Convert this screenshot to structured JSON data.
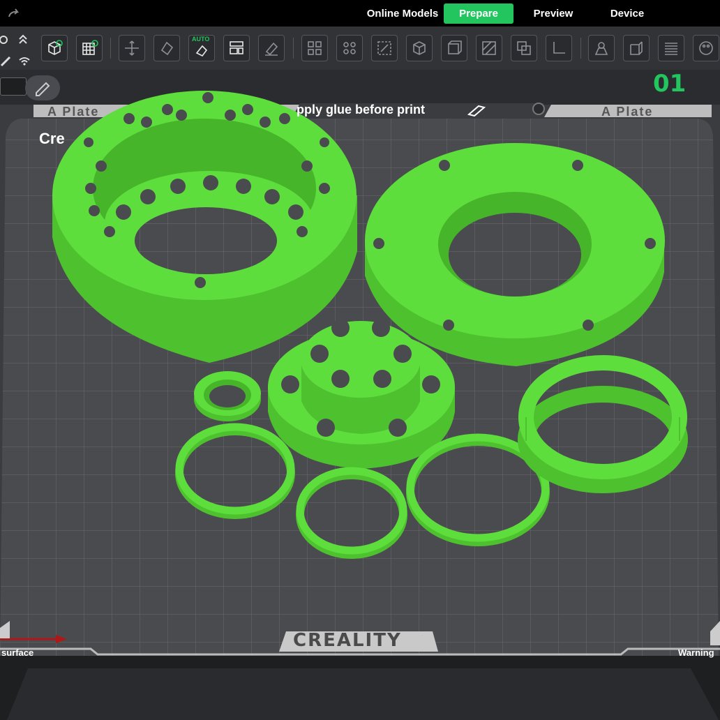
{
  "nav": {
    "tabs": [
      {
        "label": "Online Models",
        "active": false
      },
      {
        "label": "Prepare",
        "active": true
      },
      {
        "label": "Preview",
        "active": false
      },
      {
        "label": "Device",
        "active": false
      }
    ]
  },
  "toolbar": {
    "auto_label": "AUTO",
    "tools": [
      "add-object-icon",
      "add-plate-icon",
      "arrange-icon",
      "orient-icon",
      "auto-orient-icon",
      "layout-icon",
      "paint-icon",
      "split-objects-icon",
      "split-parts-icon",
      "scale-icon",
      "cube-icon",
      "hollow-icon",
      "slice-icon",
      "boolean-icon",
      "measure-icon",
      "support-icon",
      "seam-icon",
      "variable-layer-icon",
      "color-paint-icon"
    ]
  },
  "plate": {
    "number": "01",
    "left_strip_text": "A Plate",
    "right_strip_text": "A Plate",
    "glue_notice": "pply glue before print",
    "name_partial": "Cre",
    "surface_label": "surface",
    "warning_label": "Warning",
    "brand": "CREALITY"
  },
  "colors": {
    "accent": "#22c55e",
    "model": "#5ede3c",
    "bed": "#4a4b4f",
    "grid": "#6d6e72"
  }
}
